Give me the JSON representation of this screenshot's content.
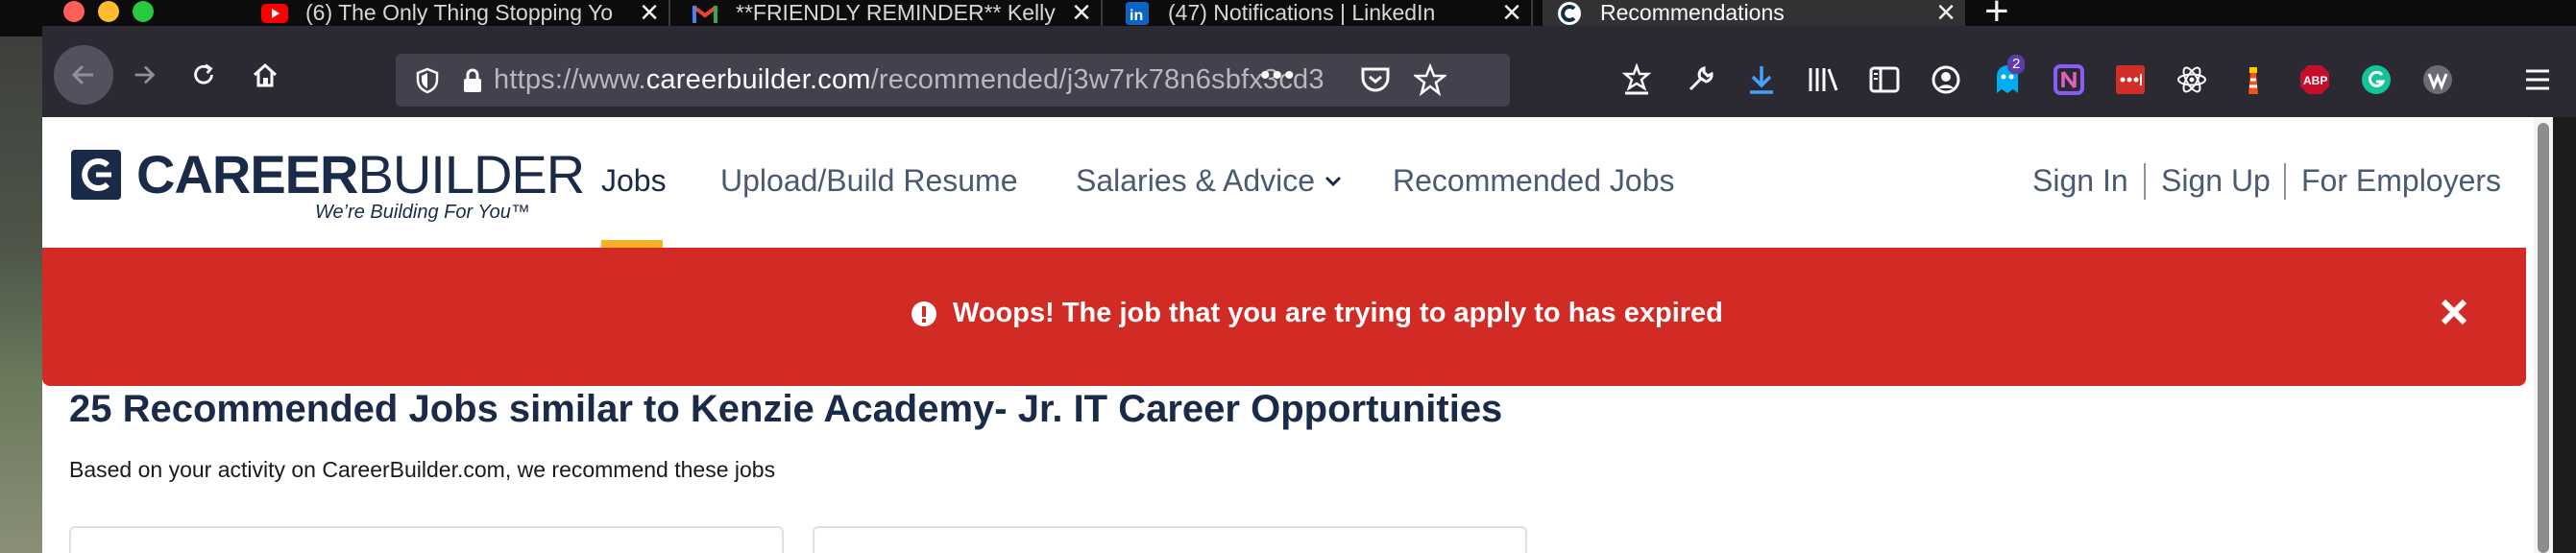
{
  "browser": {
    "tabs": [
      {
        "title": "(6) The Only Thing Stopping Yo",
        "favicon": "youtube-icon"
      },
      {
        "title": "**FRIENDLY REMINDER** Kelly",
        "favicon": "gmail-icon"
      },
      {
        "title": "(47) Notifications | LinkedIn",
        "favicon": "linkedin-icon"
      },
      {
        "title": "Recommendations",
        "favicon": "careerbuilder-icon"
      }
    ],
    "url_prefix": "https://www.",
    "url_domain": "careerbuilder.com",
    "url_path": "/recommended/j3w7rk78n6sbfx3cd3",
    "extension_badge": "2"
  },
  "site": {
    "logo_text_bold": "CAREER",
    "logo_text_light": "BUILDER",
    "logo_tagline": "We’re Building For You™",
    "nav": {
      "jobs": "Jobs",
      "upload_resume": "Upload/Build Resume",
      "salaries": "Salaries & Advice",
      "recommended": "Recommended Jobs",
      "sign_in": "Sign In",
      "sign_up": "Sign Up",
      "for_employers": "For Employers"
    }
  },
  "alert": {
    "message": "Woops! The job that you are trying to apply to has expired",
    "color": "#d22b26"
  },
  "main": {
    "heading": "25 Recommended Jobs similar to Kenzie Academy- Jr. IT Career Opportunities",
    "subheading": "Based on your activity on CareerBuilder.com, we recommend these jobs"
  },
  "colors": {
    "brand_navy": "#1a2b49",
    "nav_accent": "#f5b026"
  }
}
